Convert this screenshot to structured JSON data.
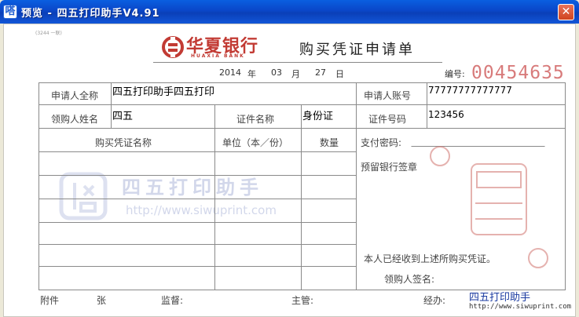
{
  "window": {
    "title": "预览 - 四五打印助手V4.91",
    "app_icon_glyph": "嗒",
    "close_glyph": "✕"
  },
  "doc": {
    "tiny_code": "(3244 一联)",
    "bank_name": "华夏银行",
    "bank_name_en": "HUAXIA BANK",
    "form_title": "购买凭证申请单",
    "date": {
      "year": "2014",
      "year_unit": "年",
      "month": "03",
      "month_unit": "月",
      "day": "27",
      "day_unit": "日"
    },
    "serial_label": "编号:",
    "serial_number": "00454635",
    "fields": {
      "applicant_name_label": "申请人全称",
      "applicant_name_value": "四五打印助手四五打印",
      "account_label": "申请人账号",
      "account_value": "77777777777777",
      "buyer_name_label": "领购人姓名",
      "buyer_name_value": "四五",
      "id_type_label": "证件名称",
      "id_type_value": "身份证",
      "id_number_label": "证件号码",
      "id_number_value": "123456",
      "voucher_name_header": "购买凭证名称",
      "unit_header": "单位（本／份）",
      "quantity_header": "数量",
      "payment_password_label": "支付密码:",
      "reserved_seal_label": "预留银行签章",
      "received_statement": "本人已经收到上述所购买凭证。",
      "buyer_sign_label": "领购人签名:"
    },
    "footer": {
      "attachment": "附件",
      "sheets": "张",
      "supervisor": "监督:",
      "manager": "主管:",
      "handler": "经办:"
    },
    "watermark": {
      "brand": "四五打印助手",
      "url": "http://www.siwuprint.com"
    },
    "branding": {
      "name": "四五打印助手",
      "url": "http://www.siwuprint.com"
    }
  },
  "colors": {
    "title_bar": "#0a46c8",
    "bank_red": "#c23b34",
    "serial_red": "#d87b7b",
    "watermark_blue": "#7f8ec6"
  }
}
